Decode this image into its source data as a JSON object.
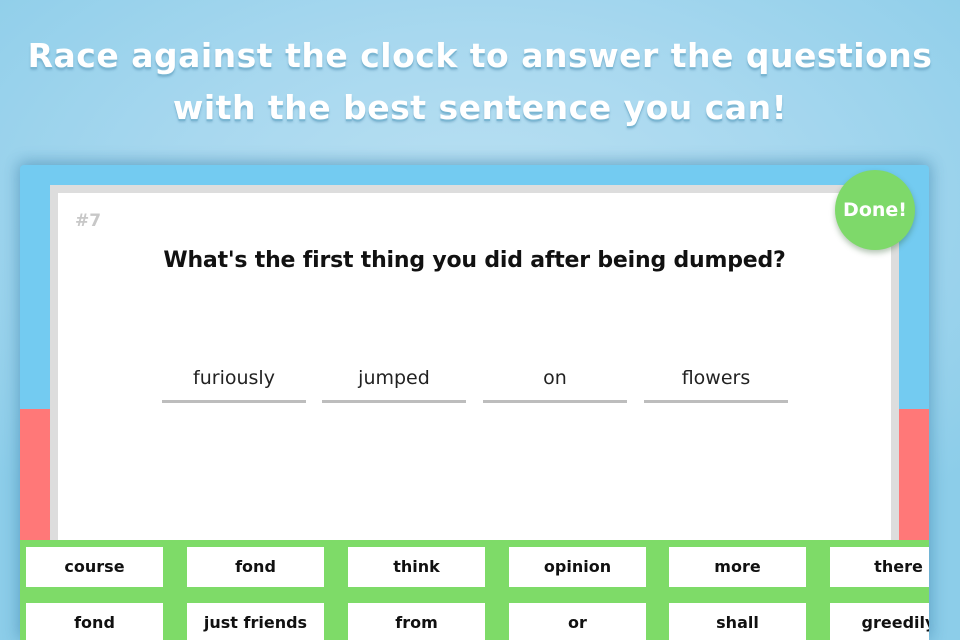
{
  "headline": {
    "line1": "Race against the clock to answer the questions",
    "line2": "with the best sentence you can!"
  },
  "timer": {
    "elapsed_fraction": 0.35,
    "colors": {
      "remaining": "#73cbf1",
      "elapsed": "#ff7878"
    }
  },
  "question": {
    "number": "#7",
    "text": "What's the first thing you did after being dumped?"
  },
  "answer_slots": [
    {
      "word": "furiously"
    },
    {
      "word": "jumped"
    },
    {
      "word": "on"
    },
    {
      "word": "flowers"
    }
  ],
  "done_button": {
    "label": "Done!",
    "color": "#7ed96a"
  },
  "word_bank": {
    "color": "#7edb68",
    "rows": [
      [
        "course",
        "fond",
        "think",
        "opinion",
        "more",
        "there"
      ],
      [
        "fond",
        "just friends",
        "from",
        "or",
        "shall",
        "greedily"
      ]
    ]
  }
}
